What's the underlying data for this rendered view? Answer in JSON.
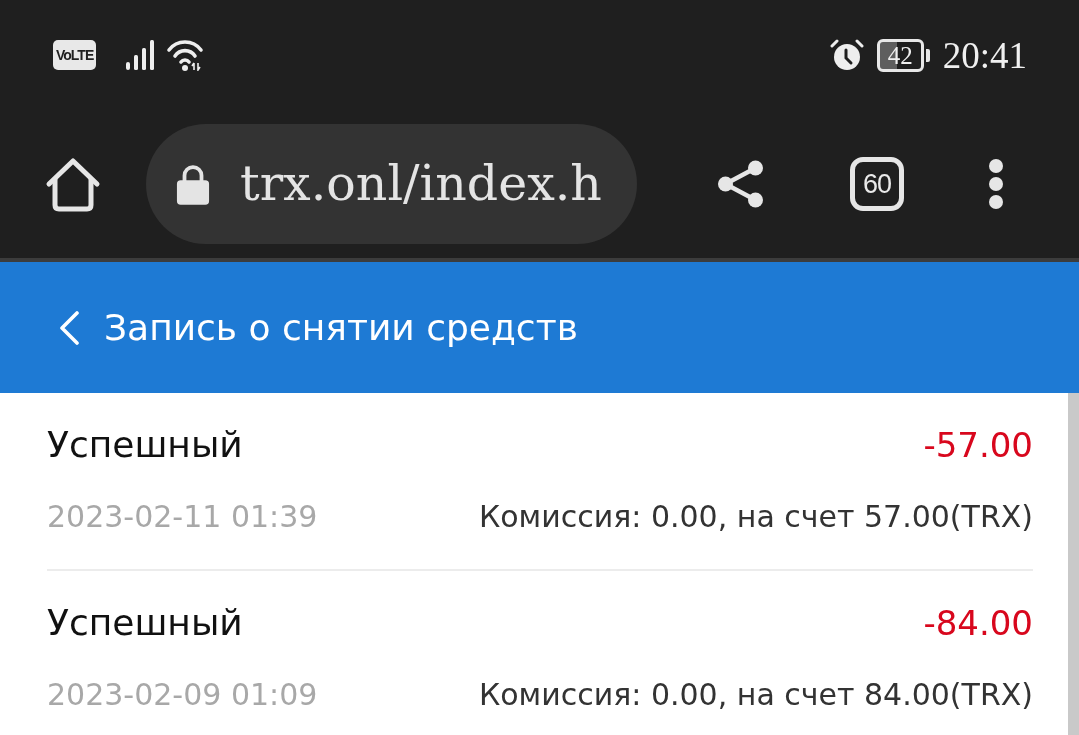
{
  "status_bar": {
    "network_badge": "VoLTE",
    "battery": "42",
    "time": "20:41"
  },
  "browser": {
    "url": "trx.onl/index.h",
    "tab_count": "60"
  },
  "header": {
    "title": "Запись о снятии средств"
  },
  "records": [
    {
      "status": "Успешный",
      "amount": "-57.00",
      "date": "2023-02-11 01:39",
      "details": "Комиссия: 0.00, на счет 57.00(TRX)"
    },
    {
      "status": "Успешный",
      "amount": "-84.00",
      "date": "2023-02-09 01:09",
      "details": "Комиссия: 0.00, на счет 84.00(TRX)"
    }
  ]
}
